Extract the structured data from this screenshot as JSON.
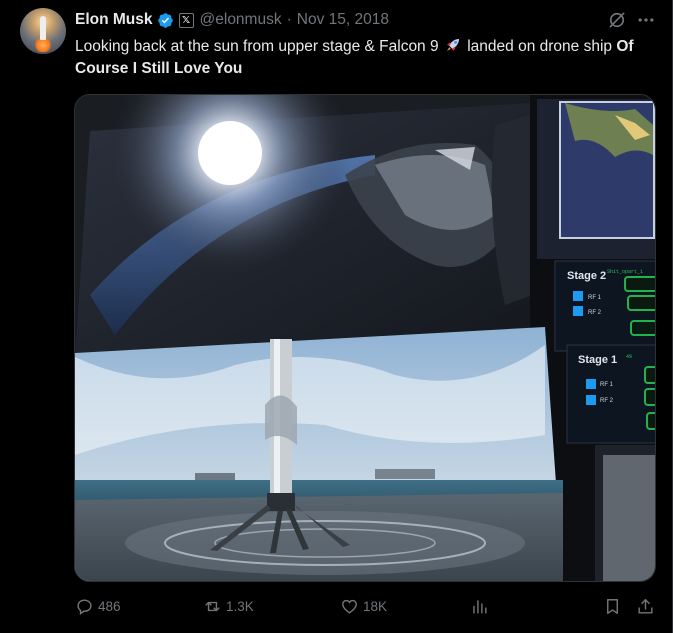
{
  "author": {
    "name": "Elon Musk",
    "handle": "@elonmusk",
    "separator": "·",
    "date": "Nov 15, 2018",
    "badge": "𝕏"
  },
  "tweet": {
    "text_part1": "Looking back at the sun from upper stage & Falcon 9",
    "text_part2": "landed on drone ship",
    "text_bold": "Of Course I Still Love You"
  },
  "media": {
    "stage2_label": "Stage 2",
    "stage1_label": "Stage 1",
    "stage2_small": "Shit_opart_1",
    "stage1_small": "4%",
    "rf1": "RF 1",
    "rf2": "RF 2"
  },
  "actions": {
    "replies": "486",
    "reposts": "1.3K",
    "likes": "18K"
  },
  "colors": {
    "accent_blue": "#1d9bf0",
    "muted": "#71767b",
    "text": "#e7e9ea",
    "background": "#000000"
  },
  "icons": [
    "verified-icon",
    "grok-icon",
    "more-icon",
    "reply-icon",
    "repost-icon",
    "like-icon",
    "views-icon",
    "bookmark-icon",
    "share-icon",
    "rocket-emoji"
  ]
}
